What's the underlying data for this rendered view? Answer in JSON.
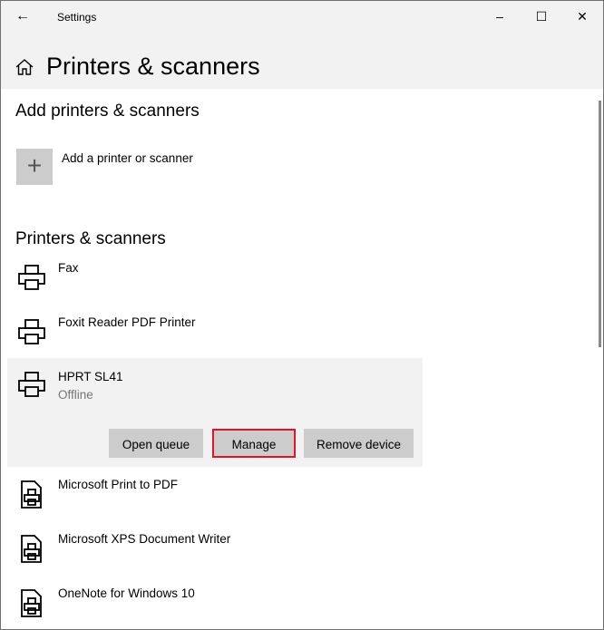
{
  "window": {
    "title": "Settings",
    "minimize": "–",
    "maximize": "☐",
    "close": "✕",
    "back": "←"
  },
  "header": {
    "title": "Printers & scanners"
  },
  "add_section": {
    "heading": "Add printers & scanners",
    "add_label": "Add a printer or scanner",
    "add_icon": "+"
  },
  "list_section": {
    "heading": "Printers & scanners"
  },
  "devices": [
    {
      "name": "Fax",
      "icon": "printer-icon"
    },
    {
      "name": "Foxit Reader PDF Printer",
      "icon": "printer-icon"
    },
    {
      "name": "HPRT SL41",
      "status": "Offline",
      "icon": "printer-icon",
      "buttons": {
        "open_queue": "Open queue",
        "manage": "Manage",
        "remove": "Remove device"
      }
    },
    {
      "name": "Microsoft Print to PDF",
      "icon": "document-printer-icon"
    },
    {
      "name": "Microsoft XPS Document Writer",
      "icon": "document-printer-icon"
    },
    {
      "name": "OneNote for Windows 10",
      "icon": "document-printer-icon"
    }
  ],
  "colors": {
    "focus": "#e81123",
    "button": "#cccccc",
    "selected": "#f2f2f2"
  }
}
